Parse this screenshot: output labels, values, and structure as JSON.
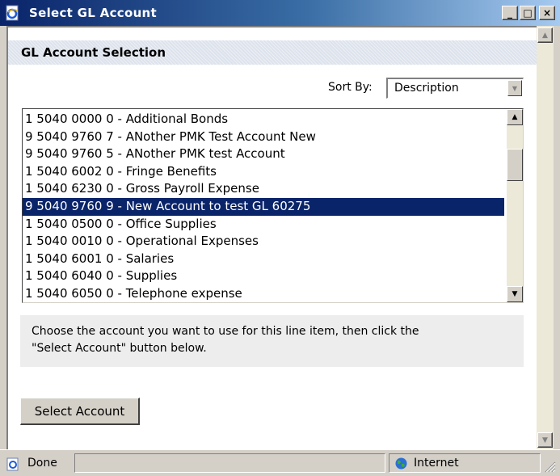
{
  "window": {
    "title": "Select GL Account",
    "minimize_glyph": "_",
    "maximize_glyph": "□",
    "close_glyph": "×"
  },
  "section": {
    "title": "GL Account Selection"
  },
  "sort": {
    "label": "Sort By:",
    "selected": "Description"
  },
  "accounts": [
    "1 5040 0000 0 - Additional Bonds",
    "9 5040 9760 7 - ANother PMK Test Account New",
    "9 5040 9760 5 - ANother PMK test Account",
    "1 5040 6002 0 - Fringe Benefits",
    "1 5040 6230 0 - Gross Payroll Expense",
    "9 5040 9760 9 - New Account to test GL 60275",
    "1 5040 0500 0 - Office Supplies",
    "1 5040 0010 0 - Operational Expenses",
    "1 5040 6001 0 - Salaries",
    "1 5040 6040 0 - Supplies",
    "1 5040 6050 0 - Telephone expense"
  ],
  "selected_index": 5,
  "instructions": {
    "line1": "Choose the account you want to use for this line item, then click the",
    "line2": "\"Select Account\" button below."
  },
  "button": {
    "label": "Select Account"
  },
  "status": {
    "left": "Done",
    "zone": "Internet"
  },
  "icons": [
    "ie-page-icon",
    "minimize-icon",
    "maximize-icon",
    "close-icon",
    "scroll-up-icon",
    "scroll-down-icon",
    "dropdown-arrow-icon",
    "globe-icon",
    "resize-grip-icon"
  ],
  "colors": {
    "selection": "#0a246a",
    "titlebar": "#0a246a",
    "panel": "#ededed",
    "chrome": "#d4d0c8"
  }
}
